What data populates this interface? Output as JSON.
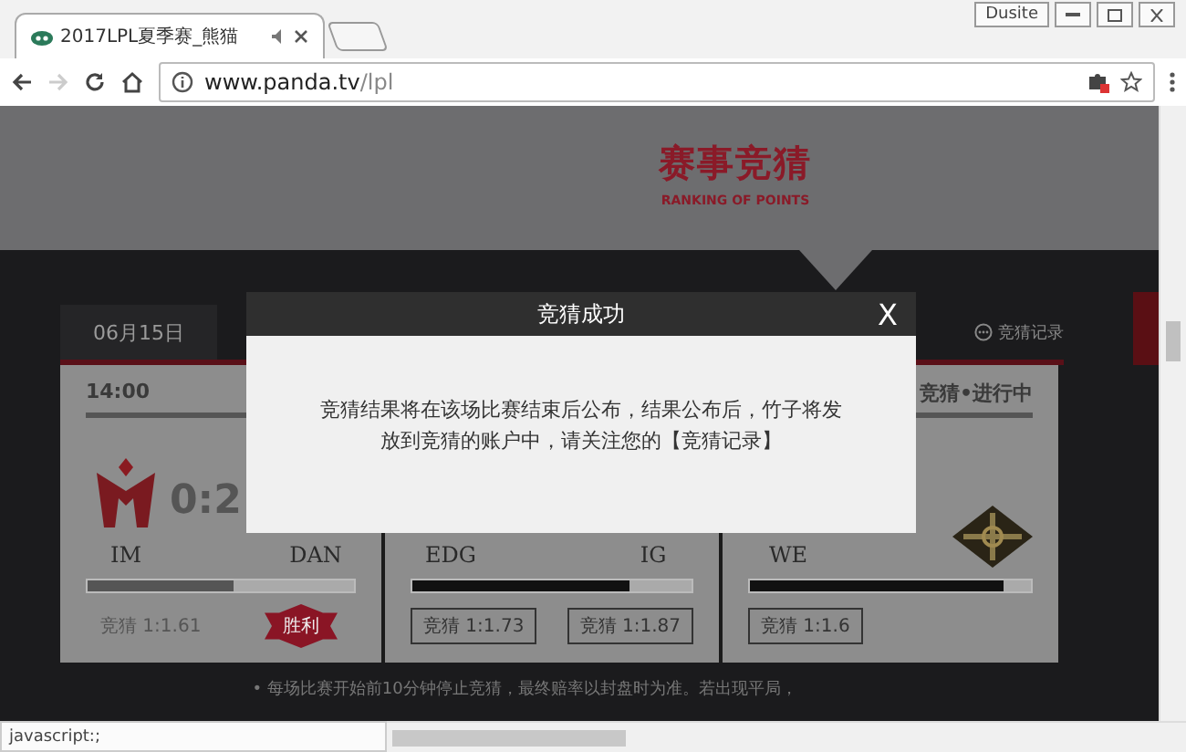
{
  "browser": {
    "tab": {
      "title": "2017LPL夏季赛_熊猫",
      "selected": true
    },
    "url": {
      "host": "www.panda.tv",
      "path": "/lpl"
    },
    "user_badge": "Dusite"
  },
  "banner": {
    "title": "赛事竞猜",
    "subtitle": "RANKING OF POINTS"
  },
  "date_tabs": [
    {
      "label": "06月15日",
      "selected": true
    }
  ],
  "record_link": "竞猜记录",
  "matches": [
    {
      "kind": "finished",
      "header": "14:00",
      "score": "0:2",
      "level": 0.55,
      "teams": [
        {
          "name": "IM",
          "odds": "竞猜 1:1.61"
        },
        {
          "name": "DAN",
          "badge": "胜利"
        }
      ]
    },
    {
      "kind": "open",
      "level": 0.78,
      "teams": [
        {
          "name": "EDG",
          "odds": "竞猜 1:1.73"
        },
        {
          "name": "IG",
          "odds": "竞猜 1:1.87"
        }
      ]
    },
    {
      "kind": "open",
      "header": "竞猜•进行中",
      "level": 0.9,
      "teams": [
        {
          "name": "WE",
          "odds": "竞猜 1:1.6"
        }
      ]
    }
  ],
  "footnote": "• 每场比赛开始前10分钟停止竞猜，最终赔率以封盘时为准。若出现平局，",
  "modal": {
    "title": "竞猜成功",
    "close": "X",
    "message": "竞猜结果将在该场比赛结束后公布，结果公布后，竹子将发放到竞猜的账户中，请关注您的【竞猜记录】"
  },
  "status_bar": "javascript:;"
}
